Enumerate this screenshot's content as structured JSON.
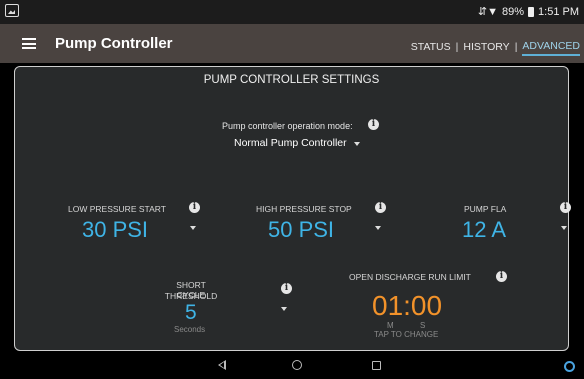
{
  "status_bar": {
    "battery": "89%",
    "time": "1:51 PM"
  },
  "app_bar": {
    "title": "Pump Controller",
    "tabs": [
      {
        "label": "STATUS",
        "active": false
      },
      {
        "label": "HISTORY",
        "active": false
      },
      {
        "label": "ADVANCED",
        "active": true
      }
    ],
    "separator": "|"
  },
  "panel": {
    "title": "PUMP CONTROLLER SETTINGS",
    "operation_mode": {
      "label": "Pump controller operation mode:",
      "value": "Normal Pump Controller"
    },
    "low_pressure_start": {
      "label": "LOW PRESSURE START",
      "value": "30 PSI"
    },
    "high_pressure_stop": {
      "label": "HIGH PRESSURE STOP",
      "value": "50 PSI"
    },
    "pump_fla": {
      "label": "PUMP FLA",
      "value": "12 A"
    },
    "short_cycle": {
      "label_line1": "SHORT CYCLE",
      "label_line2": "THRESHOLD",
      "value": "5",
      "unit": "Seconds"
    },
    "open_discharge": {
      "label": "OPEN DISCHARGE RUN LIMIT",
      "value": "01:00",
      "unit_m": "M",
      "unit_s": "S",
      "hint": "TAP TO CHANGE"
    }
  },
  "colors": {
    "accent_blue": "#3fb4e6",
    "timer_orange": "#f2922a",
    "app_bar": "#4a4340",
    "panel_bg": "#282a2b"
  }
}
